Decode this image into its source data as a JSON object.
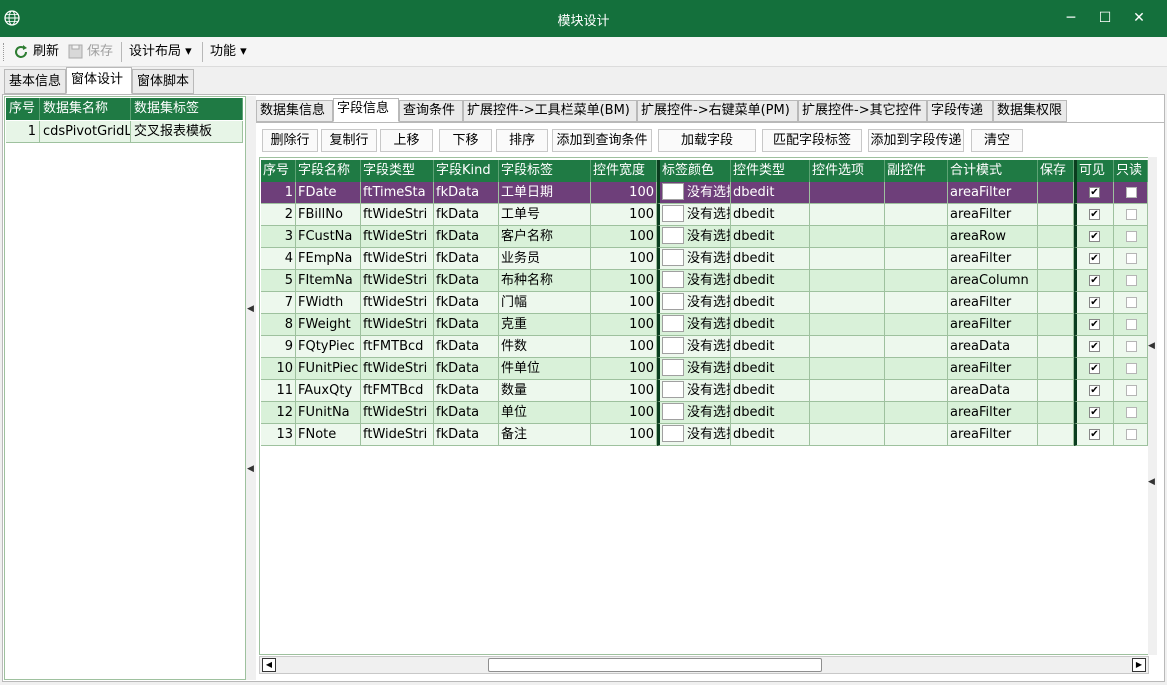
{
  "window": {
    "title": "模块设计",
    "minimize": "─",
    "maximize": "☐",
    "close": "✕"
  },
  "toolbar": {
    "refresh": "刷新",
    "save": "保存",
    "layout": "设计布局 ▾",
    "function": "功能 ▾"
  },
  "outer_tabs": [
    "基本信息",
    "窗体设计",
    "窗体脚本"
  ],
  "left_grid": {
    "headers": [
      "序号",
      "数据集名称",
      "数据集标签"
    ],
    "rows": [
      {
        "no": "1",
        "name": "cdsPivotGridLi",
        "label": "交叉报表模板"
      }
    ]
  },
  "inner_tabs": [
    "数据集信息",
    "字段信息",
    "查询条件",
    "扩展控件->工具栏菜单(BM)",
    "扩展控件->右键菜单(PM)",
    "扩展控件->其它控件",
    "字段传递",
    "数据集权限"
  ],
  "actions": [
    "删除行",
    "复制行",
    "上移",
    "下移",
    "排序",
    "添加到查询条件",
    "加载字段",
    "匹配字段标签",
    "添加到字段传递",
    "清空"
  ],
  "field_grid": {
    "headers": [
      "序号",
      "字段名称",
      "字段类型",
      "字段Kind",
      "字段标签",
      "控件宽度",
      "标签颜色",
      "控件类型",
      "控件选项",
      "副控件",
      "合计模式",
      "保存",
      "可见",
      "只读"
    ],
    "rows": [
      {
        "no": "1",
        "name": "FDate",
        "type": "ftTimeSta",
        "kind": "fkData",
        "label": "工单日期",
        "width": "100",
        "color": "没有选择",
        "ctrl": "dbedit",
        "mode": "areaFilter",
        "visible": true,
        "readonly": false
      },
      {
        "no": "2",
        "name": "FBillNo",
        "type": "ftWideStri",
        "kind": "fkData",
        "label": "工单号",
        "width": "100",
        "color": "没有选择",
        "ctrl": "dbedit",
        "mode": "areaFilter",
        "visible": true,
        "readonly": false
      },
      {
        "no": "3",
        "name": "FCustNa",
        "type": "ftWideStri",
        "kind": "fkData",
        "label": "客户名称",
        "width": "100",
        "color": "没有选择",
        "ctrl": "dbedit",
        "mode": "areaRow",
        "visible": true,
        "readonly": false
      },
      {
        "no": "4",
        "name": "FEmpNa",
        "type": "ftWideStri",
        "kind": "fkData",
        "label": "业务员",
        "width": "100",
        "color": "没有选择",
        "ctrl": "dbedit",
        "mode": "areaFilter",
        "visible": true,
        "readonly": false
      },
      {
        "no": "5",
        "name": "FItemNa",
        "type": "ftWideStri",
        "kind": "fkData",
        "label": "布种名称",
        "width": "100",
        "color": "没有选择",
        "ctrl": "dbedit",
        "mode": "areaColumn",
        "visible": true,
        "readonly": false
      },
      {
        "no": "7",
        "name": "FWidth",
        "type": "ftWideStri",
        "kind": "fkData",
        "label": "门幅",
        "width": "100",
        "color": "没有选择",
        "ctrl": "dbedit",
        "mode": "areaFilter",
        "visible": true,
        "readonly": false
      },
      {
        "no": "8",
        "name": "FWeight",
        "type": "ftWideStri",
        "kind": "fkData",
        "label": "克重",
        "width": "100",
        "color": "没有选择",
        "ctrl": "dbedit",
        "mode": "areaFilter",
        "visible": true,
        "readonly": false
      },
      {
        "no": "9",
        "name": "FQtyPiec",
        "type": "ftFMTBcd",
        "kind": "fkData",
        "label": "件数",
        "width": "100",
        "color": "没有选择",
        "ctrl": "dbedit",
        "mode": "areaData",
        "visible": true,
        "readonly": false
      },
      {
        "no": "10",
        "name": "FUnitPiec",
        "type": "ftWideStri",
        "kind": "fkData",
        "label": "件单位",
        "width": "100",
        "color": "没有选择",
        "ctrl": "dbedit",
        "mode": "areaFilter",
        "visible": true,
        "readonly": false
      },
      {
        "no": "11",
        "name": "FAuxQty",
        "type": "ftFMTBcd",
        "kind": "fkData",
        "label": "数量",
        "width": "100",
        "color": "没有选择",
        "ctrl": "dbedit",
        "mode": "areaData",
        "visible": true,
        "readonly": false
      },
      {
        "no": "12",
        "name": "FUnitNa",
        "type": "ftWideStri",
        "kind": "fkData",
        "label": "单位",
        "width": "100",
        "color": "没有选择",
        "ctrl": "dbedit",
        "mode": "areaFilter",
        "visible": true,
        "readonly": false
      },
      {
        "no": "13",
        "name": "FNote",
        "type": "ftWideStri",
        "kind": "fkData",
        "label": "备注",
        "width": "100",
        "color": "没有选择",
        "ctrl": "dbedit",
        "mode": "areaFilter",
        "visible": true,
        "readonly": false
      }
    ]
  },
  "icons": {
    "app": "globe-icon",
    "refresh": "refresh-icon",
    "save": "save-icon",
    "check": "✔"
  },
  "colors": {
    "title_bar": "#14703c",
    "grid_header": "#1f7a44",
    "selected_row": "#6e3f7a",
    "row_light": "#edf8ed",
    "row_dark": "#d9f1d9"
  }
}
